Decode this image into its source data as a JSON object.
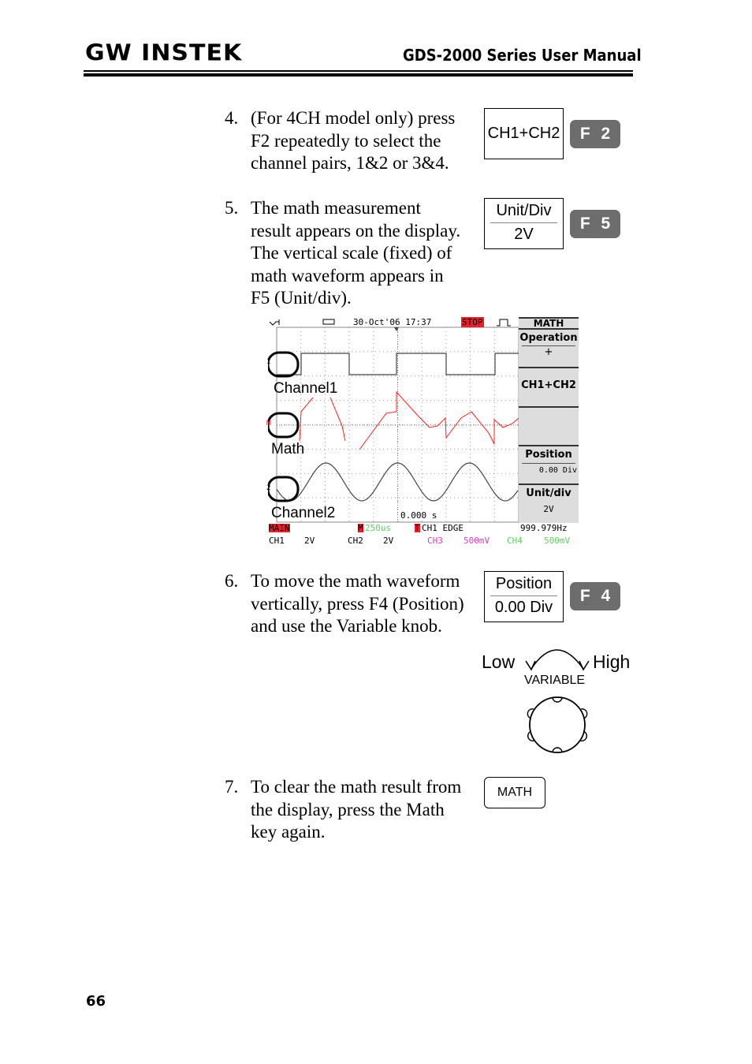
{
  "header": {
    "logo": "GW INSTEK",
    "title": "GDS-2000 Series User Manual"
  },
  "steps": [
    {
      "num": "4.",
      "text": "(For 4CH model only) press F2 repeatedly to select the channel pairs, 1&2 or 3&4."
    },
    {
      "num": "5.",
      "text": "The math measurement result appears on the display. The vertical scale (fixed) of math waveform appears in F5 (Unit/div)."
    },
    {
      "num": "6.",
      "text": "To move the math waveform vertically, press F4 (Position) and use the Variable knob."
    },
    {
      "num": "7.",
      "text": "To clear the math result from the display, press the Math key again."
    }
  ],
  "softkeys": {
    "ch_pair": {
      "label": "CH1+CH2",
      "key": "F 2"
    },
    "unit_div": {
      "label": "Unit/Div",
      "value": "2V",
      "key": "F 5"
    },
    "position": {
      "label": "Position",
      "value": "0.00 Div",
      "key": "F 4"
    }
  },
  "knob": {
    "low": "Low",
    "high": "High",
    "label": "VARIABLE"
  },
  "math_key": "MATH",
  "scope": {
    "date": "30-Oct'06 17:37",
    "status": "STOP",
    "menu_title": "MATH",
    "operation_label": "Operation",
    "operation_value": "+",
    "source": "CH1+CH2",
    "position_label": "Position",
    "position_value": "0.00 Div",
    "unit_label": "Unit/div",
    "unit_value": "2V",
    "trigger_time": "0.000 s",
    "mode": "MAIN",
    "timebase_mark": "M",
    "timebase": "250us",
    "trigger_mark": "T",
    "trigger": "CH1  EDGE",
    "frequency": "999.979Hz",
    "ch1": "CH1",
    "ch1_scale": "2V",
    "ch2": "CH2",
    "ch2_scale": "2V",
    "ch3": "CH3",
    "ch3_scale": "500mV",
    "ch4": "CH4",
    "ch4_scale": "500mV",
    "marker_ch1": "1",
    "marker_math": "M",
    "marker_ch2": "2",
    "label_ch1": "Channel1",
    "label_math": "Math",
    "label_ch2": "Channel2",
    "colors": {
      "math": "#ff2020",
      "ch3": "#e040c0",
      "ch4": "#60d060",
      "stop": "#e8202a",
      "timebase": "#60d060"
    }
  },
  "page_number": "66"
}
